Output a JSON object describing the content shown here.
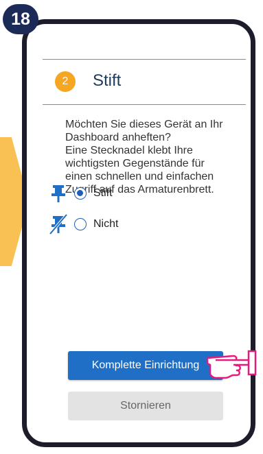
{
  "step_badge": "18",
  "section": {
    "number": "2",
    "title": "Stift"
  },
  "description": "Möchten Sie dieses Gerät an Ihr\nDashboard anheften?\nEine Stecknadel klebt Ihre\nwichtigsten Gegenstände für\neinen schnellen und einfachen\nZugriff auf das Armaturenbrett.",
  "options": [
    {
      "label": "Stift",
      "selected": true,
      "icon": "pin-icon"
    },
    {
      "label": "Nicht",
      "selected": false,
      "icon": "unpin-icon"
    }
  ],
  "buttons": {
    "complete": "Komplette Einrichtung",
    "cancel": "Stornieren"
  },
  "colors": {
    "primary_blue": "#1e6fc5",
    "accent_orange": "#f5a623",
    "badge_navy": "#1b2a57",
    "arrow_yellow": "#f9c154",
    "hand_pink": "#e8197d"
  }
}
